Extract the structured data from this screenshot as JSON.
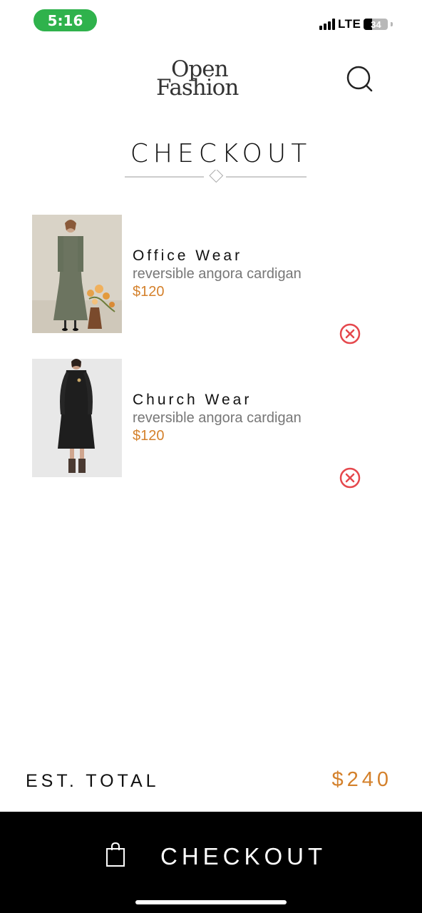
{
  "status_bar": {
    "time": "5:16",
    "network": "LTE",
    "battery": "34",
    "battery_level": 0.34,
    "time_pill_color": "#2fb24c"
  },
  "header": {
    "logo_line1": "Open",
    "logo_line2": "Fashion",
    "search_icon": "search-icon"
  },
  "page": {
    "title": "CHECKOUT"
  },
  "cart": {
    "items": [
      {
        "name": "Office Wear",
        "description": "reversible angora cardigan",
        "price": "$120",
        "remove_icon": "remove-circle-x-icon"
      },
      {
        "name": "Church Wear",
        "description": "reversible angora cardigan",
        "price": "$120",
        "remove_icon": "remove-circle-x-icon"
      }
    ]
  },
  "summary": {
    "total_label": "EST. TOTAL",
    "total_value": "$240"
  },
  "checkout_button": {
    "label": "CHECKOUT",
    "icon": "shopping-bag-icon"
  },
  "colors": {
    "accent": "#d4812c",
    "remove": "#e5484d",
    "button_bg": "#000000"
  }
}
